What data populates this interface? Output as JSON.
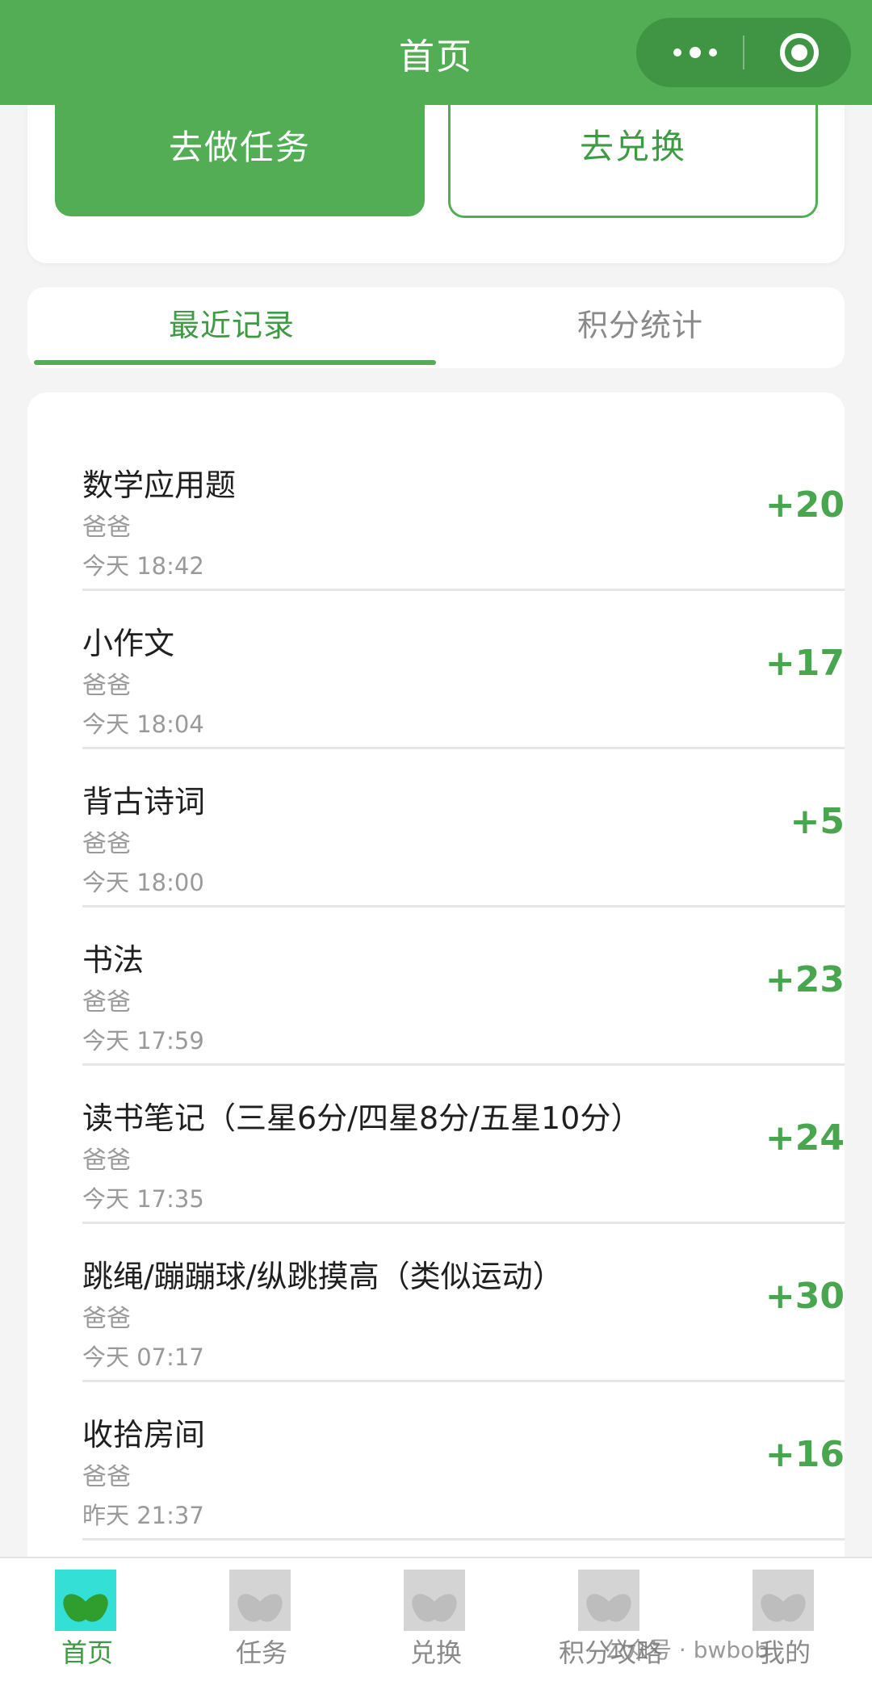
{
  "navbar": {
    "title": "首页",
    "more_icon": "more-dots-icon",
    "close_icon": "mini-program-close-icon",
    "color": "#52ad55"
  },
  "actions": {
    "task_label": "去做任务",
    "redeem_label": "去兑换"
  },
  "tabs": {
    "recent_label": "最近记录",
    "stats_label": "积分统计"
  },
  "records": [
    {
      "title": "数学应用题",
      "by": "爸爸",
      "time": "今天 18:42",
      "points": "+20"
    },
    {
      "title": "小作文",
      "by": "爸爸",
      "time": "今天 18:04",
      "points": "+17"
    },
    {
      "title": "背古诗词",
      "by": "爸爸",
      "time": "今天 18:00",
      "points": "+5"
    },
    {
      "title": "书法",
      "by": "爸爸",
      "time": "今天 17:59",
      "points": "+23"
    },
    {
      "title": "读书笔记（三星6分/四星8分/五星10分）",
      "by": "爸爸",
      "time": "今天 17:35",
      "points": "+24"
    },
    {
      "title": "跳绳/蹦蹦球/纵跳摸高（类似运动）",
      "by": "爸爸",
      "time": "今天 07:17",
      "points": "+30"
    },
    {
      "title": "收拾房间",
      "by": "爸爸",
      "time": "昨天 21:37",
      "points": "+16"
    }
  ],
  "tabbar": {
    "items": [
      {
        "label": "首页",
        "icon": "leaf-icon"
      },
      {
        "label": "任务",
        "icon": "leaf-icon"
      },
      {
        "label": "兑换",
        "icon": "leaf-icon"
      },
      {
        "label": "积分攻略",
        "icon": "leaf-icon"
      },
      {
        "label": "我的",
        "icon": "leaf-icon"
      }
    ]
  },
  "watermark": "公众号 · bwbob"
}
